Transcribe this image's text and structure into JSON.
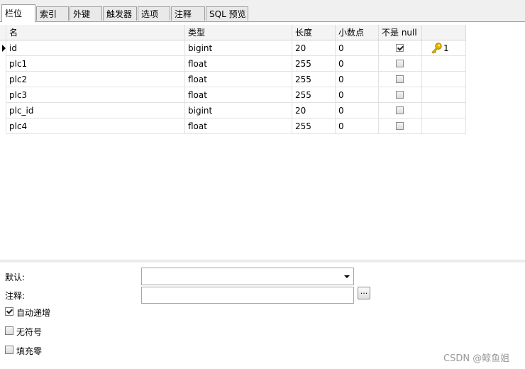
{
  "tabs": [
    {
      "label": "栏位",
      "active": true
    },
    {
      "label": "索引",
      "active": false
    },
    {
      "label": "外键",
      "active": false
    },
    {
      "label": "触发器",
      "active": false
    },
    {
      "label": "选项",
      "active": false
    },
    {
      "label": "注释",
      "active": false
    },
    {
      "label": "SQL 预览",
      "active": false
    }
  ],
  "grid": {
    "columns": [
      "名",
      "类型",
      "长度",
      "小数点",
      "不是 null",
      ""
    ],
    "rows": [
      {
        "name": "id",
        "type": "bigint",
        "length": "20",
        "decimals": "0",
        "not_null": true,
        "key": "1",
        "selected": true
      },
      {
        "name": "plc1",
        "type": "float",
        "length": "255",
        "decimals": "0",
        "not_null": false,
        "key": "",
        "selected": false
      },
      {
        "name": "plc2",
        "type": "float",
        "length": "255",
        "decimals": "0",
        "not_null": false,
        "key": "",
        "selected": false
      },
      {
        "name": "plc3",
        "type": "float",
        "length": "255",
        "decimals": "0",
        "not_null": false,
        "key": "",
        "selected": false
      },
      {
        "name": "plc_id",
        "type": "bigint",
        "length": "20",
        "decimals": "0",
        "not_null": false,
        "key": "",
        "selected": false
      },
      {
        "name": "plc4",
        "type": "float",
        "length": "255",
        "decimals": "0",
        "not_null": false,
        "key": "",
        "selected": false
      }
    ]
  },
  "properties": {
    "default_label": "默认:",
    "default_value": "",
    "comment_label": "注释:",
    "comment_value": "",
    "dots_label": "...",
    "auto_increment_label": "自动递增",
    "auto_increment_checked": true,
    "unsigned_label": "无符号",
    "unsigned_checked": false,
    "zerofill_label": "填充零",
    "zerofill_checked": false
  },
  "watermark": "CSDN @鲸鱼姐",
  "colors": {
    "key_icon": "#e6b800"
  }
}
